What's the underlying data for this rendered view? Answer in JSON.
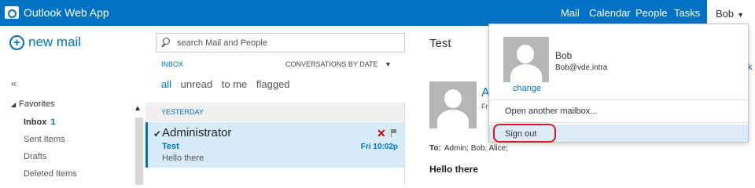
{
  "header": {
    "app_title": "Outlook Web App",
    "nav": [
      "Mail",
      "Calendar",
      "People",
      "Tasks"
    ],
    "user_button": "Bob",
    "colors": {
      "bar": "#0072c6"
    }
  },
  "sidebar": {
    "new_mail": "new mail",
    "collapse": "«",
    "favorites_label": "Favorites",
    "folders": [
      {
        "label": "Inbox",
        "count": "1"
      },
      {
        "label": "Sent Items"
      },
      {
        "label": "Drafts"
      },
      {
        "label": "Deleted Items"
      }
    ]
  },
  "list": {
    "search_placeholder": "search Mail and People",
    "folder_label": "INBOX",
    "sort_label": "CONVERSATIONS BY DATE",
    "filters": [
      "all",
      "unread",
      "to me",
      "flagged"
    ],
    "group_label": "YESTERDAY",
    "messages": [
      {
        "sender": "Administrator",
        "subject": "Test",
        "preview": "Hello there",
        "time": "Fri 10:02p"
      }
    ]
  },
  "reading": {
    "title": "Test",
    "sender_fragment": "A",
    "date_fragment": "Fri",
    "to_label": "To:",
    "recipients": "Admin;  Bob;  Alice;",
    "body": "Hello there",
    "right_fragment": "k"
  },
  "account_menu": {
    "name": "Bob",
    "email": "Bob@vde.intra",
    "change": "change",
    "open_another": "Open another mailbox...",
    "sign_out": "Sign out",
    "highlight_color": "#e0141e"
  }
}
